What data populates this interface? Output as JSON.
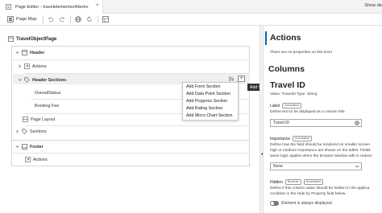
{
  "tab": {
    "title": "Page Editor - travelelementsv4demo",
    "close": "×"
  },
  "tabbar_right": "Show de",
  "toolbar": {
    "page_map": "Page Map"
  },
  "outline": {
    "root": "TravelObjectPage",
    "header_card": {
      "header": "Header",
      "actions": "Actions",
      "header_sections": "Header Sections",
      "overall_status": "OverallStatus",
      "booking_fee": "Booking Fee",
      "page_layout": "Page Layout",
      "sections": "Sections"
    },
    "footer_card": {
      "footer": "Footer",
      "actions": "Actions"
    }
  },
  "menu": {
    "items": [
      "Add Form Section",
      "Add Data Point Section",
      "Add Progress Section",
      "Add Rating Section",
      "Add Micro Chart Section"
    ],
    "add_button": "+",
    "tooltip": "Add Sections"
  },
  "props": {
    "actions_title": "Actions",
    "actions_note": "There are no properties on this level",
    "columns_title": "Columns",
    "travel_id_title": "Travel ID",
    "value_line": "Value: TravelId   Type: String",
    "label_field": "Label",
    "label_badge": "Annotation",
    "label_desc": "Define text to be displayed as a column title.",
    "label_value": "Travel ID",
    "importance_field": "Importance",
    "importance_badge": "Annotation",
    "importance_desc1": "Define how the field should be rendered on smaller screen",
    "importance_desc2": "high or medium importance are shown on the tablet. Fields",
    "importance_desc3": "same logic applies when the browser window with is reduce",
    "importance_value": "None",
    "hidden_field": "Hidden",
    "hidden_badge1": "Boolean",
    "hidden_badge2": "Annotation",
    "hidden_desc1": "Define if this column value should be hidden in the applica",
    "hidden_desc2": "condition in the Hide by Property field below.",
    "hidden_toggle_label": "Element is always displayed."
  }
}
